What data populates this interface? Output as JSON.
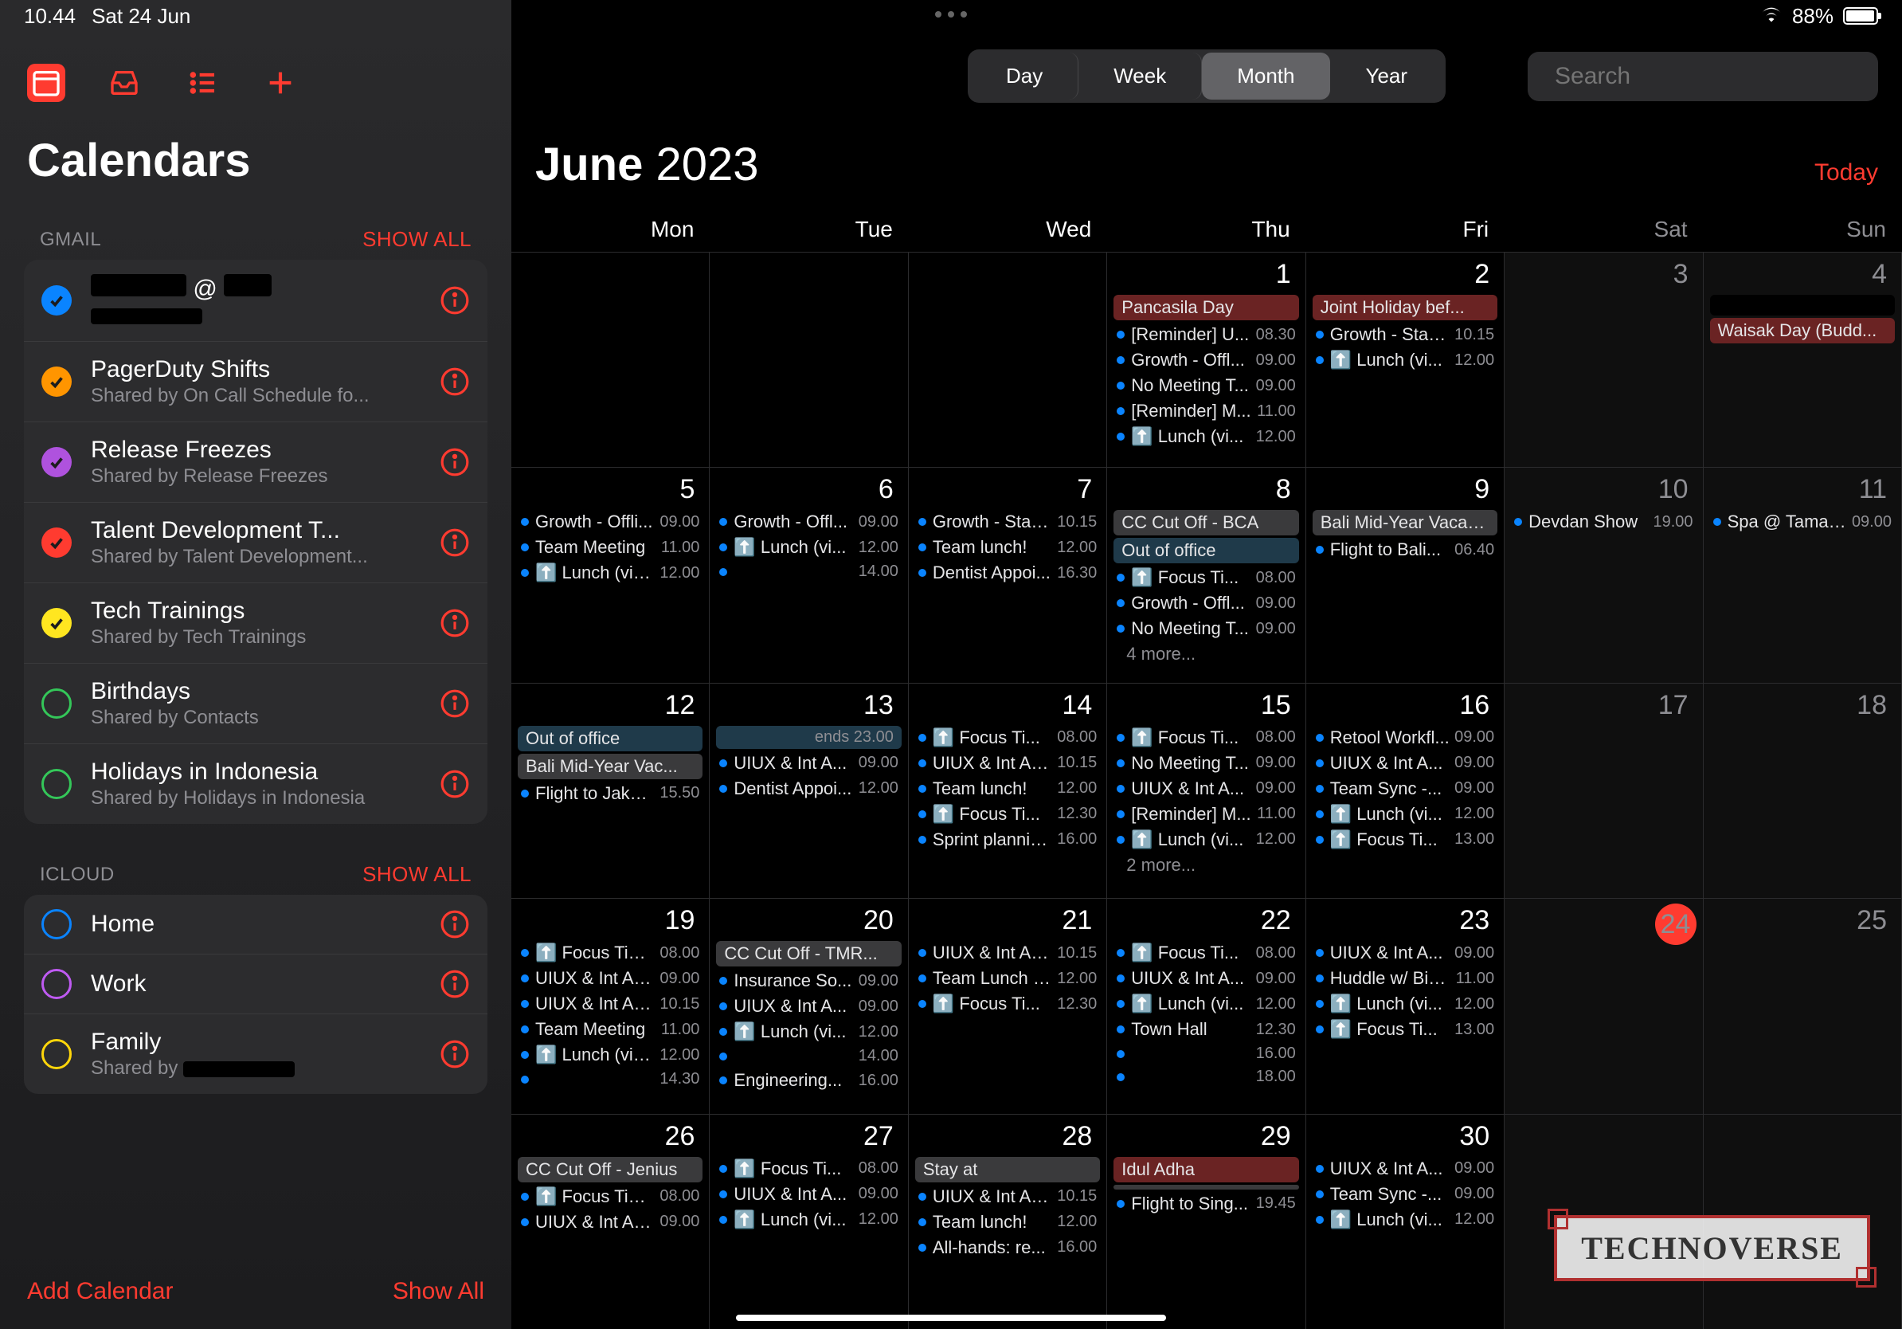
{
  "status": {
    "time": "10.44",
    "date": "Sat 24 Jun",
    "battery_pct": "88%"
  },
  "sidebar": {
    "title": "Calendars",
    "sections": [
      {
        "name": "GMAIL",
        "show_all": "SHOW ALL",
        "items": [
          {
            "name_redacted": true,
            "at": "@",
            "sub_redacted": true,
            "color": "#0a84ff",
            "checked": true
          },
          {
            "name": "PagerDuty Shifts",
            "sub": "Shared by On Call Schedule fo...",
            "color": "#ff9500",
            "checked": true
          },
          {
            "name": "Release Freezes",
            "sub": "Shared by Release Freezes",
            "color": "#af52de",
            "checked": true
          },
          {
            "name": "Talent Development T...",
            "sub": "Shared by Talent Development...",
            "color": "#ff3b30",
            "checked": true
          },
          {
            "name": "Tech Trainings",
            "sub": "Shared by Tech Trainings",
            "color": "#ffe620",
            "checked": true
          },
          {
            "name": "Birthdays",
            "sub": "Shared by Contacts",
            "color": "#34c759",
            "checked": false
          },
          {
            "name": "Holidays in Indonesia",
            "sub": "Shared by Holidays in Indonesia",
            "color": "#34c759",
            "checked": false
          }
        ]
      },
      {
        "name": "ICLOUD",
        "show_all": "SHOW ALL",
        "items": [
          {
            "name": "Home",
            "color": "#0a84ff",
            "checked": false
          },
          {
            "name": "Work",
            "color": "#bf5af2",
            "checked": false
          },
          {
            "name": "Family",
            "sub_prefix": "Shared by ",
            "sub_redacted": true,
            "color": "#ffd60a",
            "checked": false
          }
        ]
      }
    ],
    "footer": {
      "add": "Add Calendar",
      "show_all": "Show All"
    }
  },
  "toolbar": {
    "segments": [
      "Day",
      "Week",
      "Month",
      "Year"
    ],
    "active": "Month",
    "search_placeholder": "Search"
  },
  "month": {
    "name": "June",
    "year": "2023",
    "today": "Today"
  },
  "weekdays": [
    "Mon",
    "Tue",
    "Wed",
    "Thu",
    "Fri",
    "Sat",
    "Sun"
  ],
  "days": [
    {
      "num": "",
      "events": []
    },
    {
      "num": "",
      "events": []
    },
    {
      "num": "",
      "events": []
    },
    {
      "num": "1",
      "events": [
        {
          "type": "bar",
          "cls": "holiday",
          "title": "Pancasila Day"
        },
        {
          "type": "dot",
          "color": "#0a84ff",
          "title": "[Reminder] U...",
          "time": "08.30"
        },
        {
          "type": "dot",
          "color": "#0a84ff",
          "title": "Growth - Offl...",
          "time": "09.00"
        },
        {
          "type": "dot",
          "color": "#0a84ff",
          "title": "No Meeting T...",
          "time": "09.00"
        },
        {
          "type": "dot",
          "color": "#0a84ff",
          "title": "[Reminder] M...",
          "time": "11.00"
        },
        {
          "type": "dot",
          "color": "#0a84ff",
          "title": "⬆️ Lunch (vi...",
          "time": "12.00"
        }
      ]
    },
    {
      "num": "2",
      "events": [
        {
          "type": "bar",
          "cls": "holiday",
          "title": "Joint Holiday bef..."
        },
        {
          "type": "dot",
          "color": "#0a84ff",
          "title": "Growth - Stan...",
          "time": "10.15"
        },
        {
          "type": "dot",
          "color": "#0a84ff",
          "title": "⬆️ Lunch (vi...",
          "time": "12.00"
        }
      ]
    },
    {
      "num": "3",
      "weekend": true,
      "events": []
    },
    {
      "num": "4",
      "weekend": true,
      "events": [
        {
          "type": "bar",
          "cls": "redact",
          "title": " "
        },
        {
          "type": "bar",
          "cls": "holiday",
          "title": "Waisak Day (Budd..."
        }
      ]
    },
    {
      "num": "5",
      "events": [
        {
          "type": "dot",
          "color": "#0a84ff",
          "title": "Growth - Offli...",
          "time": "09.00"
        },
        {
          "type": "dot",
          "color": "#0a84ff",
          "title": "Team Meeting",
          "time": "11.00"
        },
        {
          "type": "dot",
          "color": "#0a84ff",
          "title": "⬆️ Lunch (via...",
          "time": "12.00"
        }
      ]
    },
    {
      "num": "6",
      "events": [
        {
          "type": "dot",
          "color": "#0a84ff",
          "title": "Growth - Offl...",
          "time": "09.00"
        },
        {
          "type": "dot",
          "color": "#0a84ff",
          "title": "⬆️ Lunch (vi...",
          "time": "12.00"
        },
        {
          "type": "dot",
          "color": "#0a84ff",
          "title": "",
          "time": "14.00"
        }
      ]
    },
    {
      "num": "7",
      "events": [
        {
          "type": "dot",
          "color": "#0a84ff",
          "title": "Growth - Stan...",
          "time": "10.15"
        },
        {
          "type": "dot",
          "color": "#0a84ff",
          "title": "Team lunch!",
          "time": "12.00"
        },
        {
          "type": "dot",
          "color": "#0a84ff",
          "title": "Dentist Appoi...",
          "time": "16.30"
        }
      ]
    },
    {
      "num": "8",
      "events": [
        {
          "type": "bar",
          "cls": "",
          "title": "CC Cut Off - BCA"
        },
        {
          "type": "bar",
          "cls": "ooo",
          "title": "Out of office"
        },
        {
          "type": "dot",
          "color": "#0a84ff",
          "title": "⬆️ Focus Ti...",
          "time": "08.00"
        },
        {
          "type": "dot",
          "color": "#0a84ff",
          "title": "Growth - Offl...",
          "time": "09.00"
        },
        {
          "type": "dot",
          "color": "#0a84ff",
          "title": "No Meeting T...",
          "time": "09.00"
        },
        {
          "type": "more",
          "title": "4 more..."
        }
      ]
    },
    {
      "num": "9",
      "events": [
        {
          "type": "bar",
          "cls": "",
          "title": "Bali Mid-Year Vacation"
        },
        {
          "type": "dot",
          "color": "#0a84ff",
          "title": "Flight to Bali...",
          "time": "06.40"
        }
      ]
    },
    {
      "num": "10",
      "weekend": true,
      "events": [
        {
          "type": "dot",
          "color": "#0a84ff",
          "title": "Devdan Show",
          "time": "19.00"
        }
      ]
    },
    {
      "num": "11",
      "weekend": true,
      "events": [
        {
          "type": "dot",
          "color": "#0a84ff",
          "title": "Spa @ Taman...",
          "time": "09.00"
        }
      ]
    },
    {
      "num": "12",
      "events": [
        {
          "type": "bar",
          "cls": "ooo",
          "title": "Out of office"
        },
        {
          "type": "bar",
          "cls": "",
          "title": "Bali Mid-Year Vac..."
        },
        {
          "type": "dot",
          "color": "#0a84ff",
          "title": "Flight to Jakar...",
          "time": "15.50"
        }
      ]
    },
    {
      "num": "13",
      "events": [
        {
          "type": "bar",
          "cls": "ooo",
          "title": "",
          "right": "ends 23.00"
        },
        {
          "type": "dot",
          "color": "#0a84ff",
          "title": "UIUX & Int A...",
          "time": "09.00"
        },
        {
          "type": "dot",
          "color": "#0a84ff",
          "title": "Dentist Appoi...",
          "time": "12.00"
        }
      ]
    },
    {
      "num": "14",
      "events": [
        {
          "type": "dot",
          "color": "#0a84ff",
          "title": "⬆️ Focus Ti...",
          "time": "08.00"
        },
        {
          "type": "dot",
          "color": "#0a84ff",
          "title": "UIUX & Int AP...",
          "time": "10.15"
        },
        {
          "type": "dot",
          "color": "#0a84ff",
          "title": "Team lunch!",
          "time": "12.00"
        },
        {
          "type": "dot",
          "color": "#0a84ff",
          "title": "⬆️ Focus Ti...",
          "time": "12.30"
        },
        {
          "type": "dot",
          "color": "#0a84ff",
          "title": "Sprint plannin...",
          "time": "16.00"
        }
      ]
    },
    {
      "num": "15",
      "events": [
        {
          "type": "dot",
          "color": "#0a84ff",
          "title": "⬆️ Focus Ti...",
          "time": "08.00"
        },
        {
          "type": "dot",
          "color": "#0a84ff",
          "title": "No Meeting T...",
          "time": "09.00"
        },
        {
          "type": "dot",
          "color": "#0a84ff",
          "title": "UIUX & Int A...",
          "time": "09.00"
        },
        {
          "type": "dot",
          "color": "#0a84ff",
          "title": "[Reminder] M...",
          "time": "11.00"
        },
        {
          "type": "dot",
          "color": "#0a84ff",
          "title": "⬆️ Lunch (vi...",
          "time": "12.00"
        },
        {
          "type": "more",
          "title": "2 more..."
        }
      ]
    },
    {
      "num": "16",
      "events": [
        {
          "type": "dot",
          "color": "#0a84ff",
          "title": "Retool Workfl...",
          "time": "09.00"
        },
        {
          "type": "dot",
          "color": "#0a84ff",
          "title": "UIUX & Int A...",
          "time": "09.00"
        },
        {
          "type": "dot",
          "color": "#0a84ff",
          "title": "Team Sync -...",
          "time": "09.00"
        },
        {
          "type": "dot",
          "color": "#0a84ff",
          "title": "⬆️ Lunch (vi...",
          "time": "12.00"
        },
        {
          "type": "dot",
          "color": "#0a84ff",
          "title": "⬆️ Focus Ti...",
          "time": "13.00"
        }
      ]
    },
    {
      "num": "17",
      "weekend": true,
      "events": []
    },
    {
      "num": "18",
      "weekend": true,
      "events": []
    },
    {
      "num": "19",
      "events": [
        {
          "type": "dot",
          "color": "#0a84ff",
          "title": "⬆️ Focus Tim...",
          "time": "08.00"
        },
        {
          "type": "dot",
          "color": "#0a84ff",
          "title": "UIUX & Int AP...",
          "time": "09.00"
        },
        {
          "type": "dot",
          "color": "#0a84ff",
          "title": "UIUX & Int API...",
          "time": "10.15"
        },
        {
          "type": "dot",
          "color": "#0a84ff",
          "title": "Team Meeting",
          "time": "11.00"
        },
        {
          "type": "dot",
          "color": "#0a84ff",
          "title": "⬆️ Lunch (via...",
          "time": "12.00"
        },
        {
          "type": "dot",
          "color": "#0a84ff",
          "title": "",
          "time": "14.30"
        }
      ]
    },
    {
      "num": "20",
      "events": [
        {
          "type": "bar",
          "cls": "",
          "title": "CC Cut Off - TMR..."
        },
        {
          "type": "dot",
          "color": "#0a84ff",
          "title": "Insurance So...",
          "time": "09.00"
        },
        {
          "type": "dot",
          "color": "#0a84ff",
          "title": "UIUX & Int A...",
          "time": "09.00"
        },
        {
          "type": "dot",
          "color": "#0a84ff",
          "title": "⬆️ Lunch (vi...",
          "time": "12.00"
        },
        {
          "type": "dot",
          "color": "#0a84ff",
          "title": "",
          "time": "14.00"
        },
        {
          "type": "dot",
          "color": "#0a84ff",
          "title": "Engineering...",
          "time": "16.00"
        }
      ]
    },
    {
      "num": "21",
      "events": [
        {
          "type": "dot",
          "color": "#0a84ff",
          "title": "UIUX & Int AP...",
          "time": "10.15"
        },
        {
          "type": "dot",
          "color": "#0a84ff",
          "title": "Team Lunch -...",
          "time": "12.00"
        },
        {
          "type": "dot",
          "color": "#0a84ff",
          "title": "⬆️ Focus Ti...",
          "time": "12.30"
        }
      ]
    },
    {
      "num": "22",
      "events": [
        {
          "type": "dot",
          "color": "#0a84ff",
          "title": "⬆️ Focus Ti...",
          "time": "08.00"
        },
        {
          "type": "dot",
          "color": "#0a84ff",
          "title": "UIUX & Int A...",
          "time": "09.00"
        },
        {
          "type": "dot",
          "color": "#0a84ff",
          "title": "⬆️ Lunch (vi...",
          "time": "12.00"
        },
        {
          "type": "dot",
          "color": "#0a84ff",
          "title": "Town Hall",
          "time": "12.30"
        },
        {
          "type": "dot",
          "color": "#0a84ff",
          "title": "",
          "time": "16.00"
        },
        {
          "type": "dot",
          "color": "#0a84ff",
          "title": "",
          "time": "18.00"
        }
      ]
    },
    {
      "num": "23",
      "events": [
        {
          "type": "dot",
          "color": "#0a84ff",
          "title": "UIUX & Int A...",
          "time": "09.00"
        },
        {
          "type": "dot",
          "color": "#0a84ff",
          "title": "Huddle w/ Bin...",
          "time": "11.00"
        },
        {
          "type": "dot",
          "color": "#0a84ff",
          "title": "⬆️ Lunch (vi...",
          "time": "12.00"
        },
        {
          "type": "dot",
          "color": "#0a84ff",
          "title": "⬆️ Focus Ti...",
          "time": "13.00"
        }
      ]
    },
    {
      "num": "24",
      "weekend": true,
      "today": true,
      "events": []
    },
    {
      "num": "25",
      "weekend": true,
      "events": []
    },
    {
      "num": "26",
      "events": [
        {
          "type": "bar",
          "cls": "",
          "title": "CC Cut Off - Jenius"
        },
        {
          "type": "dot",
          "color": "#0a84ff",
          "title": "⬆️ Focus Tim...",
          "time": "08.00"
        },
        {
          "type": "dot",
          "color": "#0a84ff",
          "title": "UIUX & Int AP...",
          "time": "09.00"
        }
      ]
    },
    {
      "num": "27",
      "events": [
        {
          "type": "dot",
          "color": "#0a84ff",
          "title": "⬆️ Focus Ti...",
          "time": "08.00"
        },
        {
          "type": "dot",
          "color": "#0a84ff",
          "title": "UIUX & Int A...",
          "time": "09.00"
        },
        {
          "type": "dot",
          "color": "#0a84ff",
          "title": "⬆️ Lunch (vi...",
          "time": "12.00"
        }
      ]
    },
    {
      "num": "28",
      "events": [
        {
          "type": "bar",
          "cls": "",
          "title": "Stay at"
        },
        {
          "type": "dot",
          "color": "#0a84ff",
          "title": "UIUX & Int AP...",
          "time": "10.15"
        },
        {
          "type": "dot",
          "color": "#0a84ff",
          "title": "Team lunch!",
          "time": "12.00"
        },
        {
          "type": "dot",
          "color": "#0a84ff",
          "title": "All-hands: re...",
          "time": "16.00"
        }
      ]
    },
    {
      "num": "29",
      "events": [
        {
          "type": "bar",
          "cls": "holiday",
          "title": "Idul Adha"
        },
        {
          "type": "bar",
          "cls": "",
          "title": ""
        },
        {
          "type": "dot",
          "color": "#0a84ff",
          "title": "Flight to Sing...",
          "time": "19.45"
        }
      ]
    },
    {
      "num": "30",
      "events": [
        {
          "type": "dot",
          "color": "#0a84ff",
          "title": "UIUX & Int A...",
          "time": "09.00"
        },
        {
          "type": "dot",
          "color": "#0a84ff",
          "title": "Team Sync -...",
          "time": "09.00"
        },
        {
          "type": "dot",
          "color": "#0a84ff",
          "title": "⬆️ Lunch (vi...",
          "time": "12.00"
        }
      ]
    },
    {
      "num": "",
      "weekend": true,
      "events": []
    },
    {
      "num": "",
      "weekend": true,
      "events": []
    }
  ],
  "watermark": "TECHNOVERSE"
}
